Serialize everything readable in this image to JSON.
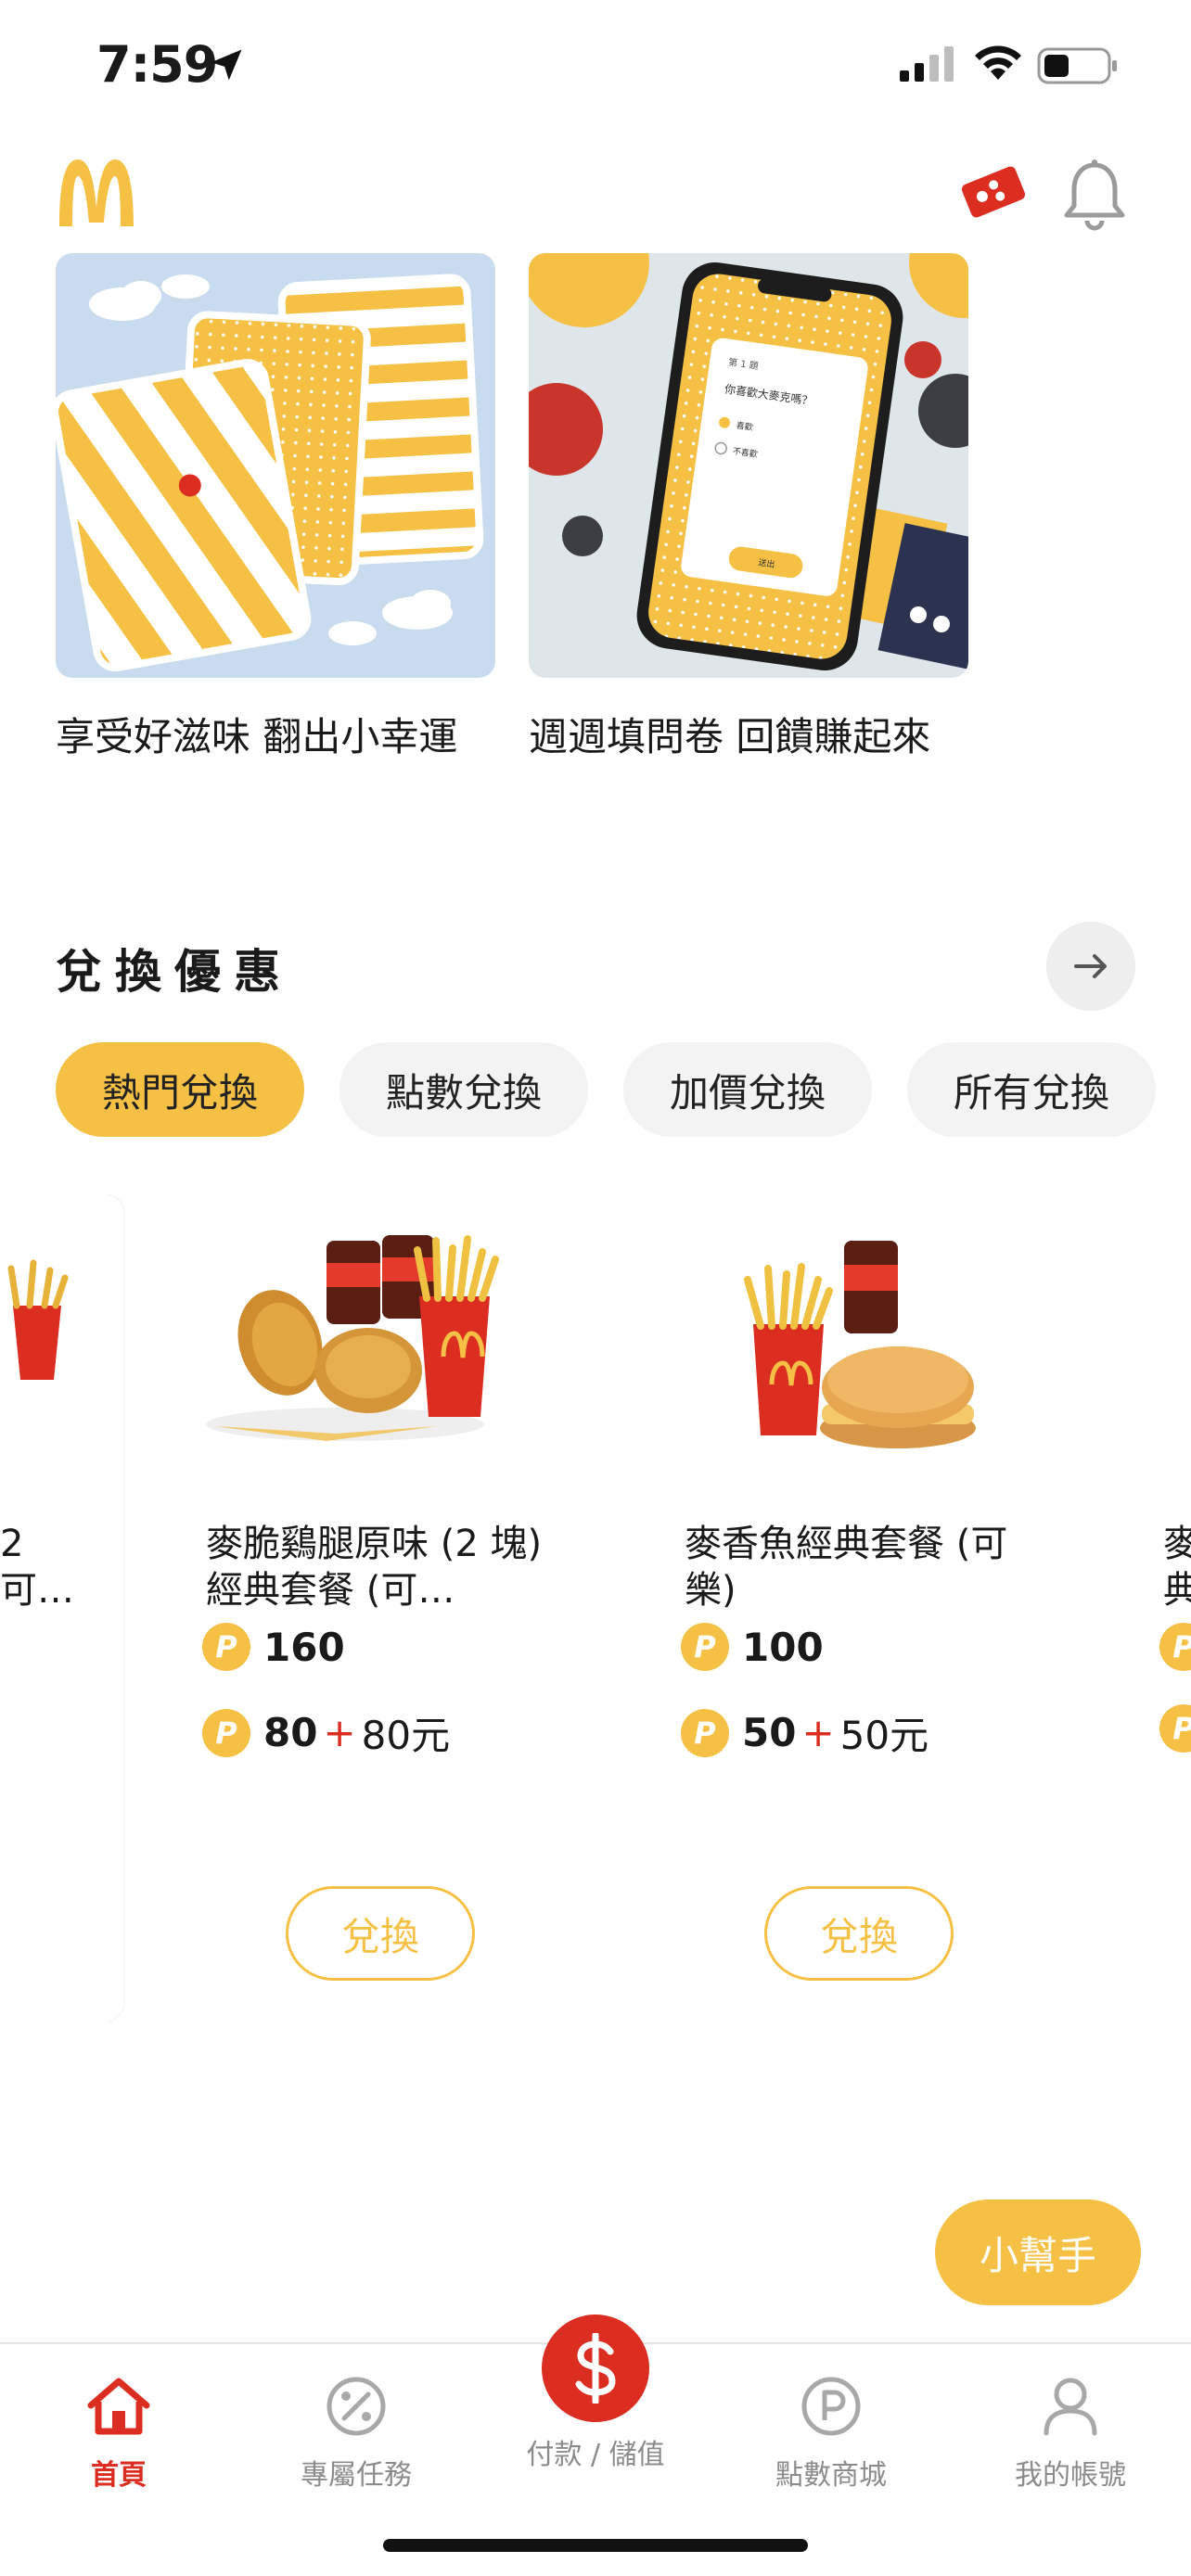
{
  "status_bar": {
    "time": "7:59"
  },
  "promos": [
    {
      "title": "享受好滋味 翻出小幸運"
    },
    {
      "title": "週週填問卷 回饋賺起來"
    }
  ],
  "survey_art": {
    "q_no": "第 1 題",
    "question": "你喜歡大麥克嗎？",
    "opt1": "喜歡",
    "opt2": "不喜歡",
    "btn": "送出"
  },
  "section": {
    "title": "兌換優惠"
  },
  "tabs": [
    {
      "label": "熱門兌換"
    },
    {
      "label": "點數兌換"
    },
    {
      "label": "加價兌換"
    },
    {
      "label": "所有兌換"
    }
  ],
  "cards": [
    {
      "name": "2\n可…",
      "points": "",
      "combo_points": "",
      "combo_cash": ""
    },
    {
      "name": "麥脆鷄腿原味 (2 塊) 經典套餐 (可…",
      "points": "160",
      "combo_points": "80",
      "combo_cash": "80元",
      "redeem_label": "兌換"
    },
    {
      "name": "麥香魚經典套餐 (可樂)",
      "points": "100",
      "combo_points": "50",
      "combo_cash": "50元",
      "redeem_label": "兌換"
    },
    {
      "name": "麥\n典",
      "points": "",
      "combo_points": "",
      "combo_cash": ""
    }
  ],
  "points_symbol": "P",
  "plus_symbol": "+",
  "helper": {
    "label": "小幫手"
  },
  "nav": [
    {
      "label": "首頁"
    },
    {
      "label": "專屬任務"
    },
    {
      "label": "付款 / 儲值"
    },
    {
      "label": "點數商城"
    },
    {
      "label": "我的帳號"
    }
  ],
  "colors": {
    "brand_yellow": "#f5c044",
    "brand_red": "#db2d20"
  }
}
